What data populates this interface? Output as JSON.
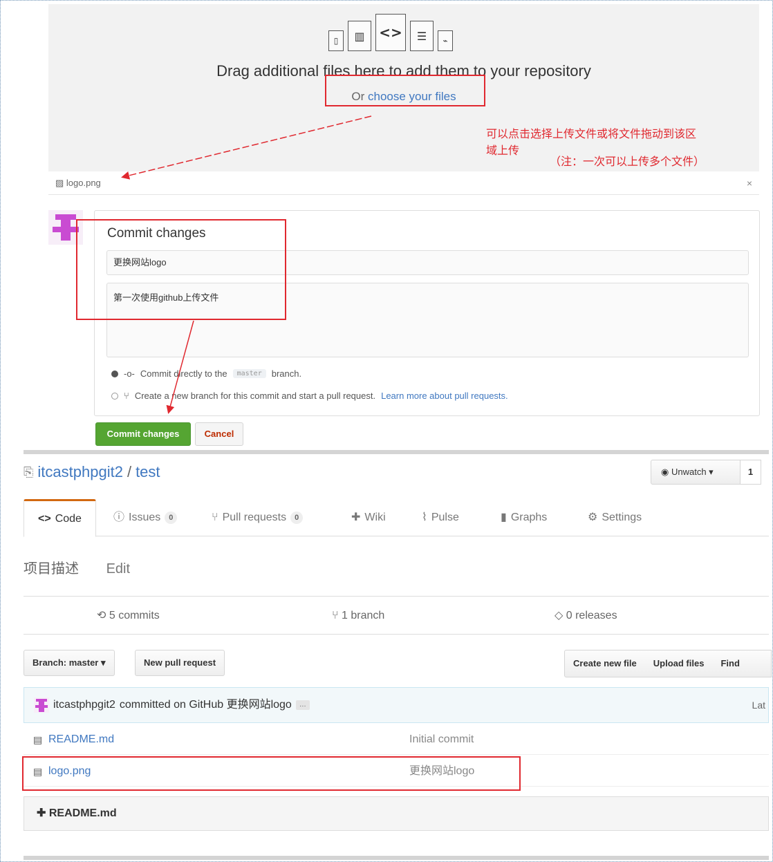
{
  "upload": {
    "icons": [
      "file-zip-icon",
      "file-chart-icon",
      "file-code-icon",
      "file-text-icon",
      "file-pdf-icon"
    ],
    "drag_text": "Drag additional files here to add them to your repository",
    "or_text": "Or ",
    "choose_link": "choose your files",
    "staged_file": "logo.png",
    "remove_glyph": "×"
  },
  "annotations": {
    "line1": "可以点击选择上传文件或将文件拖动到该区",
    "line2": "域上传",
    "line3": "（注：一次可以上传多个文件）"
  },
  "commit_form": {
    "title": "Commit changes",
    "summary_value": "更换网站logo",
    "description_value": "第一次使用github上传文件",
    "option_direct_prefix": "Commit directly to the",
    "branch_tag": "master",
    "option_direct_suffix": "branch.",
    "option_new_branch": "Create a new branch for this commit and start a pull request.",
    "option_learn_more": "Learn more about pull requests.",
    "commit_button": "Commit changes",
    "cancel_button": "Cancel"
  },
  "repo": {
    "owner": "itcastphpgit2",
    "separator": "/",
    "name": "test",
    "watch_label": "Unwatch",
    "watch_count": "1",
    "tabs": [
      {
        "label": "Code",
        "icon": "code-icon"
      },
      {
        "label": "Issues",
        "count": "0",
        "icon": "issue-icon"
      },
      {
        "label": "Pull requests",
        "count": "0",
        "icon": "pull-request-icon"
      },
      {
        "label": "Wiki",
        "icon": "wiki-icon"
      },
      {
        "label": "Pulse",
        "icon": "pulse-icon"
      },
      {
        "label": "Graphs",
        "icon": "graph-icon"
      },
      {
        "label": "Settings",
        "icon": "gear-icon"
      }
    ],
    "description": "项目描述",
    "edit_label": "Edit",
    "stats": {
      "commits": "5 commits",
      "branches": "1 branch",
      "releases": "0 releases"
    },
    "branch_button": "Branch: master",
    "new_pr_button": "New pull request",
    "create_file": "Create new file",
    "upload_files": "Upload files",
    "find_file": "Find",
    "latest_commit": {
      "author": "itcastphpgit2",
      "text": "committed on GitHub 更换网站logo",
      "more": "…",
      "latest_label": "Lat"
    },
    "files": [
      {
        "name": "README.md",
        "message": "Initial commit"
      },
      {
        "name": "logo.png",
        "message": "更换网站logo"
      }
    ],
    "readme_title": "README.md"
  },
  "colors": {
    "annotation_red": "#e0282f",
    "link_blue": "#4078c0",
    "commit_green": "#55a532",
    "tab_orange": "#d26911"
  }
}
